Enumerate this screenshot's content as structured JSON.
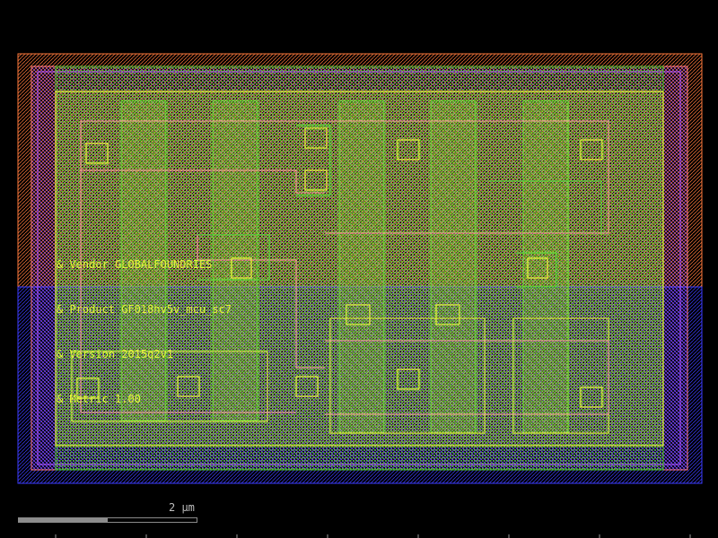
{
  "labels": {
    "vendor": "& Vendor GLOBALFOUNDRIES",
    "product": "& Product GF018hv5v_mcu_sc7",
    "version": "& Version 2015q2v1",
    "metric": "& Metric 1.00"
  },
  "scalebar": {
    "label": "2 µm",
    "fill_fraction": 0.5
  },
  "colors": {
    "background": "#000000",
    "nwell": "#ff7a3c",
    "pwell": "#3c3cff",
    "boundary": "#a94dff",
    "diffusion": "#4fbf2a",
    "active_outline": "#e6f53c",
    "metal": "#ff9aa0",
    "label": "#e6f53c"
  }
}
